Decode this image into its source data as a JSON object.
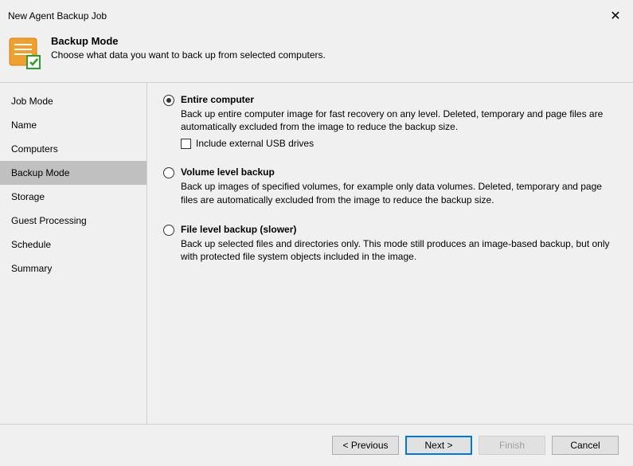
{
  "titlebar": {
    "title": "New Agent Backup Job"
  },
  "header": {
    "title": "Backup Mode",
    "subtitle": "Choose what data you want to back up from selected computers."
  },
  "sidebar": {
    "items": [
      {
        "label": "Job Mode"
      },
      {
        "label": "Name"
      },
      {
        "label": "Computers"
      },
      {
        "label": "Backup Mode"
      },
      {
        "label": "Storage"
      },
      {
        "label": "Guest Processing"
      },
      {
        "label": "Schedule"
      },
      {
        "label": "Summary"
      }
    ]
  },
  "options": {
    "entire": {
      "title": "Entire computer",
      "desc": "Back up entire computer image for fast recovery on any level. Deleted, temporary and page files are automatically excluded from the image to reduce the backup size.",
      "usb_label": "Include external USB drives"
    },
    "volume": {
      "title": "Volume level backup",
      "desc": "Back up images of specified volumes, for example only data volumes. Deleted, temporary and page files are automatically excluded from the image to reduce the backup size."
    },
    "file": {
      "title": "File level backup (slower)",
      "desc": "Back up selected files and directories only. This mode still produces an image-based backup, but only with protected file system objects included in the image."
    }
  },
  "footer": {
    "previous": "< Previous",
    "next": "Next >",
    "finish": "Finish",
    "cancel": "Cancel"
  }
}
